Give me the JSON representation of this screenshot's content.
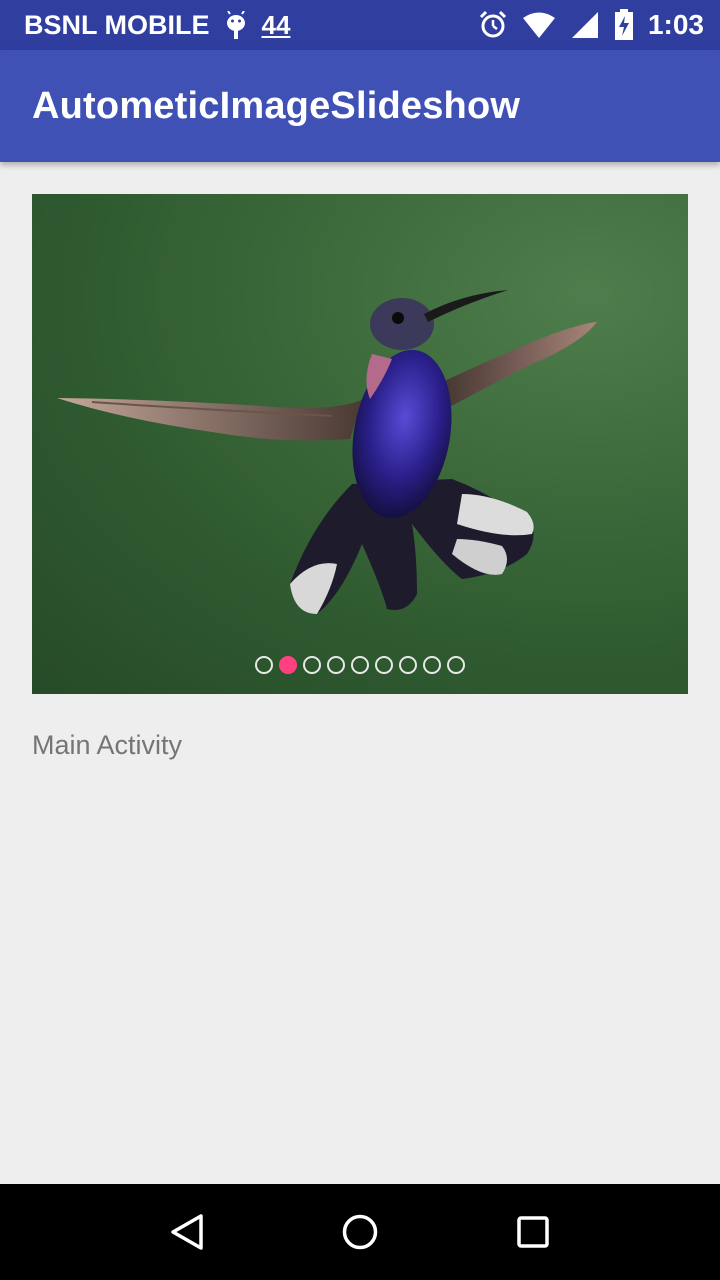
{
  "status_bar": {
    "carrier": "BSNL MOBILE",
    "notification_count": "44",
    "time": "1:03"
  },
  "app_bar": {
    "title": "AutometicImageSlideshow"
  },
  "slideshow": {
    "image_subject": "hummingbird",
    "slide_count": 9,
    "active_index": 1,
    "dot_color": "#e8e8e8",
    "active_dot_color": "#ff4081"
  },
  "main": {
    "label": "Main Activity"
  },
  "nav_bar": {
    "back_icon": "back-triangle-icon",
    "home_icon": "home-circle-icon",
    "recents_icon": "recents-square-icon"
  },
  "colors": {
    "status_bar": "#303f9f",
    "app_bar": "#3f51b5",
    "accent": "#ff4081",
    "background": "#eeeeee"
  }
}
